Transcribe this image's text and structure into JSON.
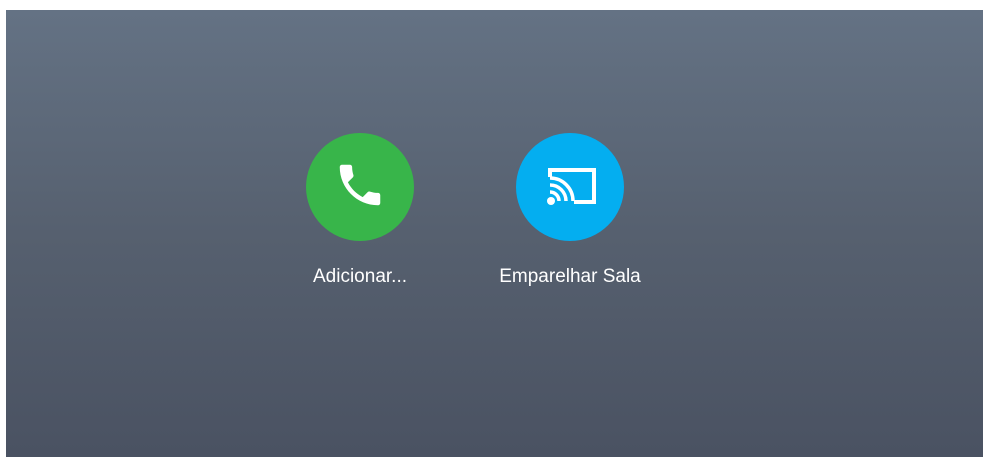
{
  "actions": [
    {
      "label": "Adicionar...",
      "icon": "phone-icon",
      "color": "#38b54a"
    },
    {
      "label": "Emparelhar Sala",
      "icon": "cast-icon",
      "color": "#04aef0"
    }
  ],
  "background": {
    "top": "#647284",
    "bottom": "#4a5262"
  }
}
